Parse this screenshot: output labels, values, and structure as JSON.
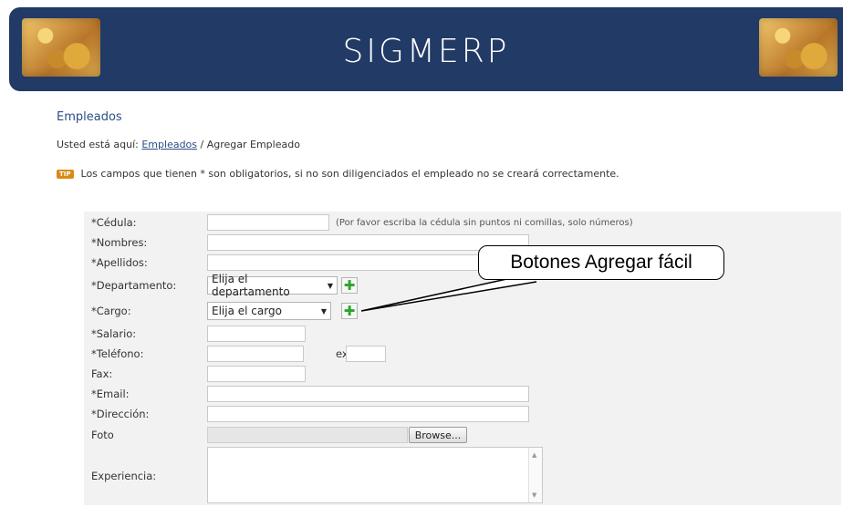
{
  "header": {
    "title": "SIGMERP",
    "icon_left": "gears-image",
    "icon_right": "gears-image"
  },
  "page": {
    "section_title": "Empleados",
    "breadcrumb_prefix": "Usted está aquí:",
    "breadcrumb_link": "Empleados",
    "breadcrumb_current": "/ Agregar Empleado",
    "tip_badge": "TIP",
    "tip_text": "Los campos que tienen * son obligatorios, si no son diligenciados el empleado no se creará correctamente."
  },
  "form": {
    "cedula_label": "*Cédula:",
    "cedula_hint": "(Por favor escriba la cédula sin puntos ni comillas, solo números)",
    "nombres_label": "*Nombres:",
    "apellidos_label": "*Apellidos:",
    "departamento_label": "*Departamento:",
    "departamento_value": "Elija el departamento",
    "cargo_label": "*Cargo:",
    "cargo_value": "Elija el cargo",
    "salario_label": "*Salario:",
    "telefono_label": "*Teléfono:",
    "ext_label": "ext.",
    "fax_label": "Fax:",
    "email_label": "*Email:",
    "direccion_label": "*Dirección:",
    "foto_label": "Foto",
    "browse_label": "Browse...",
    "experiencia_label": "Experiencia:"
  },
  "annotation": {
    "callout_text": "Botones Agregar fácil"
  }
}
